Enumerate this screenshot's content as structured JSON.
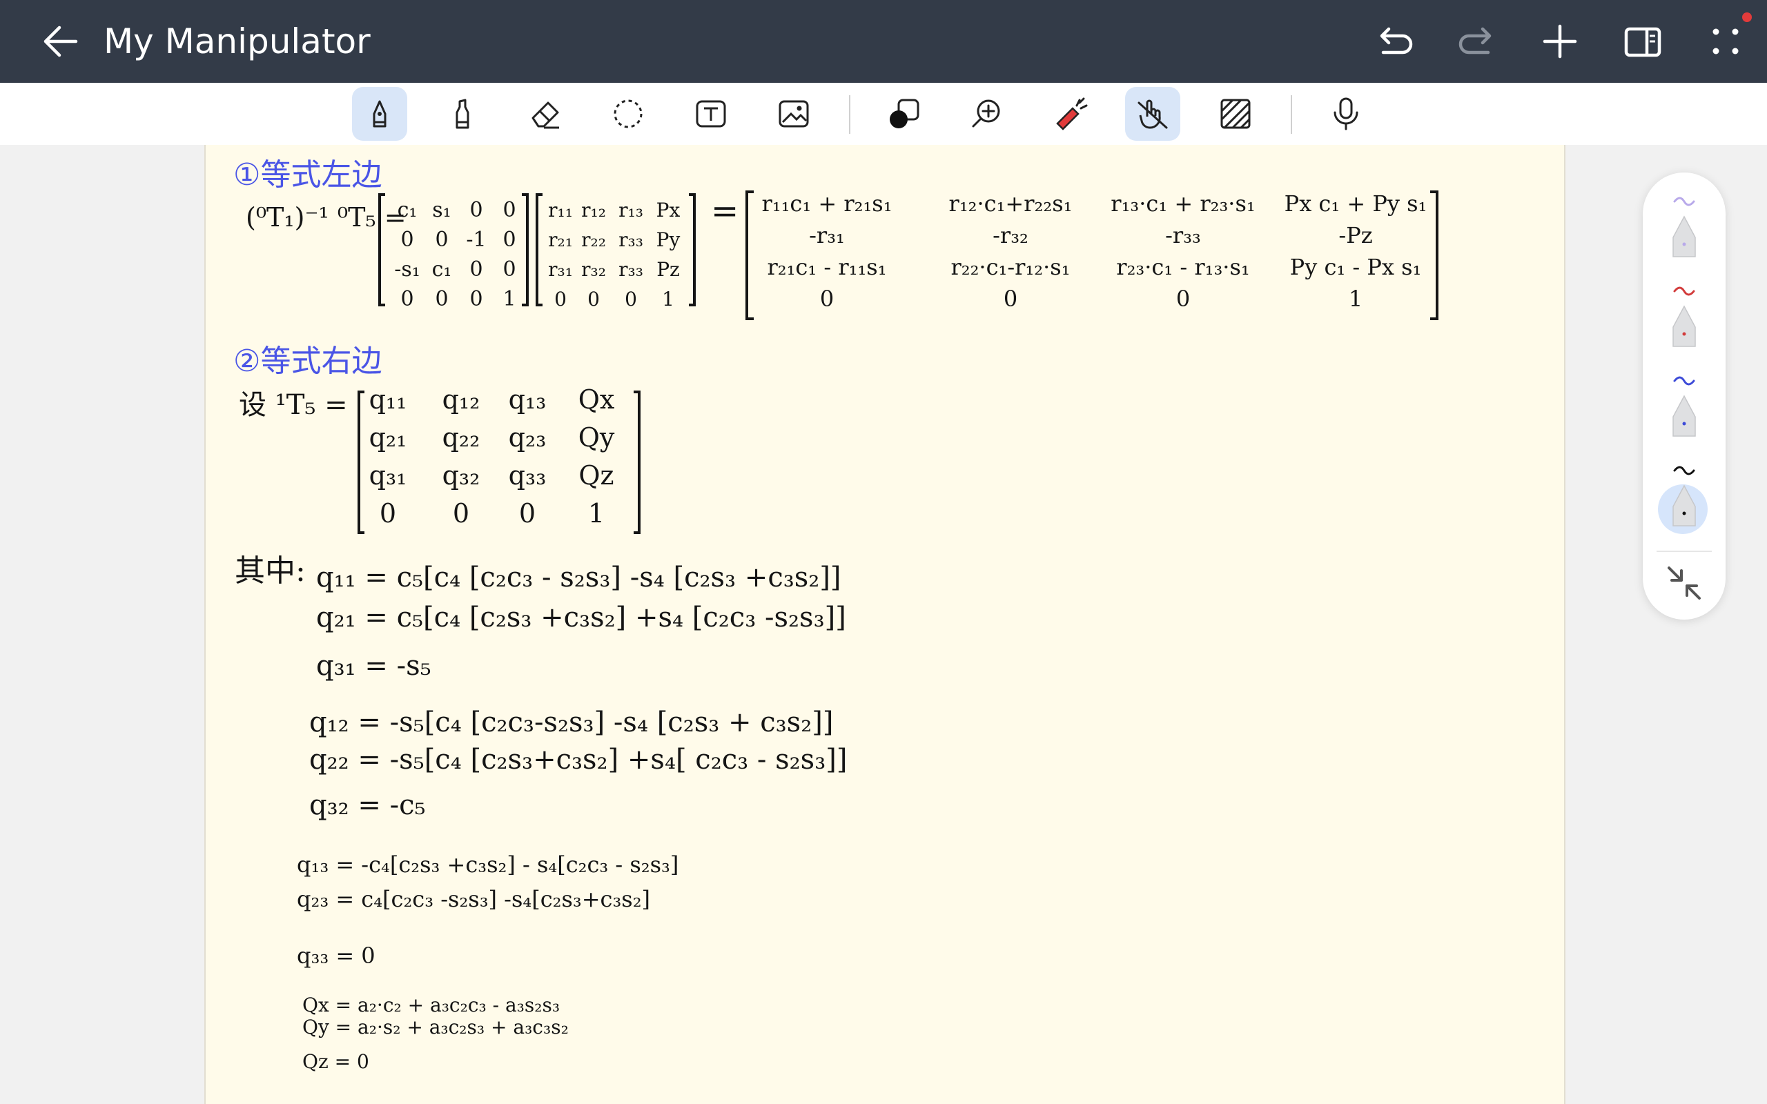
{
  "app": {
    "title": "My Manipulator"
  },
  "topbar": {
    "back_icon": "arrow-left-icon",
    "actions": [
      "undo-icon",
      "redo-icon",
      "add-icon",
      "split-view-icon",
      "more-icon"
    ]
  },
  "toolbar": {
    "tools": [
      "pen",
      "highlighter",
      "eraser",
      "lasso",
      "text-box",
      "image",
      "shape",
      "zoom",
      "laser-pointer",
      "finger-draw",
      "background-pattern",
      "microphone"
    ],
    "active": [
      "pen",
      "finger-draw"
    ]
  },
  "pen_panel": {
    "pens": [
      {
        "color": "#b8a9ea"
      },
      {
        "color": "#d23b3b"
      },
      {
        "color": "#3d4bd8"
      },
      {
        "color": "#111111"
      }
    ],
    "selected_index": 3
  },
  "notes": {
    "heading1": "①等式左边",
    "eq1_lhs": "(⁰T₁)⁻¹ ⁰T₅ =",
    "m1": [
      [
        "c₁",
        "s₁",
        "0",
        "0"
      ],
      [
        "0",
        "0",
        "-1",
        "0"
      ],
      [
        "-s₁",
        "c₁",
        "0",
        "0"
      ],
      [
        "0",
        "0",
        "0",
        "1"
      ]
    ],
    "m2": [
      [
        "r₁₁",
        "r₁₂",
        "r₁₃",
        "Px"
      ],
      [
        "r₂₁",
        "r₂₂",
        "r₃₃",
        "Py"
      ],
      [
        "r₃₁",
        "r₃₂",
        "r₃₃",
        "Pz"
      ],
      [
        "0",
        "0",
        "0",
        "1"
      ]
    ],
    "m3": [
      [
        "r₁₁c₁ + r₂₁s₁",
        "r₁₂·c₁+r₂₂s₁",
        "r₁₃·c₁ + r₂₃·s₁",
        "Px c₁ + Py s₁"
      ],
      [
        "-r₃₁",
        "-r₃₂",
        "-r₃₃",
        "-Pz"
      ],
      [
        "r₂₁c₁ - r₁₁s₁",
        "r₂₂·c₁-r₁₂·s₁",
        "r₂₃·c₁ - r₁₃·s₁",
        "Py c₁ - Px s₁"
      ],
      [
        "0",
        "0",
        "0",
        "1"
      ]
    ],
    "heading2": "②等式右边",
    "eq2_lhs": "设 ¹T₅ =",
    "m4": [
      [
        "q₁₁",
        "q₁₂",
        "q₁₃",
        "Qx"
      ],
      [
        "q₂₁",
        "q₂₂",
        "q₂₃",
        "Qy"
      ],
      [
        "q₃₁",
        "q₃₂",
        "q₃₃",
        "Qz"
      ],
      [
        "0",
        "0",
        "0",
        "1"
      ]
    ],
    "where_label": "其中:",
    "lines": [
      "q₁₁ = c₅[c₄ [c₂c₃ - s₂s₃] -s₄ [c₂s₃ +c₃s₂]]",
      "q₂₁ = c₅[c₄ [c₂s₃ +c₃s₂] +s₄ [c₂c₃ -s₂s₃]]",
      "q₃₁ = -s₅",
      "q₁₂ = -s₅[c₄ [c₂c₃-s₂s₃] -s₄ [c₂s₃ + c₃s₂]]",
      "q₂₂ = -s₅[c₄ [c₂s₃+c₃s₂] +s₄[ c₂c₃ - s₂s₃]]",
      "q₃₂ = -c₅",
      "q₁₃ = -c₄[c₂s₃ +c₃s₂] - s₄[c₂c₃ - s₂s₃]",
      "q₂₃ =  c₄[c₂c₃ -s₂s₃] -s₄[c₂s₃+c₃s₂]",
      "q₃₃ = 0",
      "Qx = a₂·c₂ + a₃c₂c₃ - a₃s₂s₃",
      "Qy = a₂·s₂ + a₃c₂s₃ + a₃c₃s₂",
      "Qz = 0"
    ]
  }
}
